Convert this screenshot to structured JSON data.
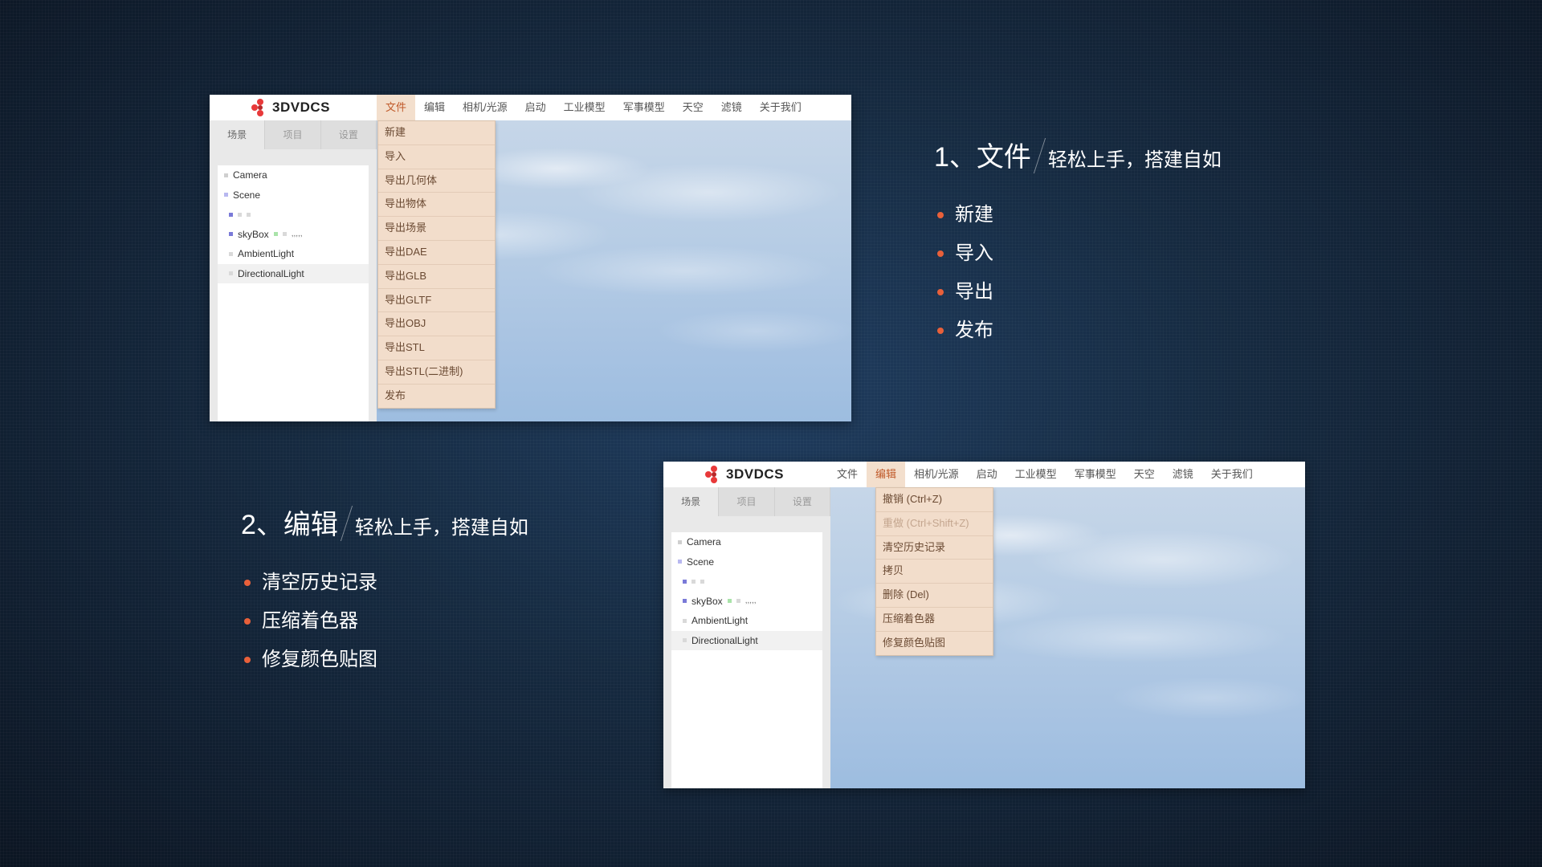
{
  "colors": {
    "accent": "#e8603a",
    "menu_active_bg": "#f3dfcd",
    "dropdown_bg": "#f2ddcb",
    "logo_red": "#e8393a"
  },
  "logo": {
    "text": "3DVDCS",
    "icon": "logo-dots-icon"
  },
  "menu": [
    "文件",
    "编辑",
    "相机/光源",
    "启动",
    "工业模型",
    "军事模型",
    "天空",
    "滤镜",
    "关于我们"
  ],
  "sidebar": {
    "tabs": [
      "场景",
      "项目",
      "设置"
    ],
    "tree": {
      "camera": "Camera",
      "scene": "Scene",
      "skybox": "skyBox",
      "skybox_suffix": ",,,,,",
      "ambient": "AmbientLight",
      "directional": "DirectionalLight"
    }
  },
  "panel1": {
    "active_menu": "文件",
    "dropdown": [
      "新建",
      "导入",
      "导出几何体",
      "导出物体",
      "导出场景",
      "导出DAE",
      "导出GLB",
      "导出GLTF",
      "导出OBJ",
      "导出STL",
      "导出STL(二进制)",
      "发布"
    ]
  },
  "panel2": {
    "active_menu": "编辑",
    "dropdown": [
      {
        "label": "撤销 (Ctrl+Z)",
        "disabled": false
      },
      {
        "label": "重做 (Ctrl+Shift+Z)",
        "disabled": true
      },
      {
        "label": "清空历史记录",
        "disabled": false
      },
      {
        "label": "拷贝",
        "disabled": false
      },
      {
        "label": "删除 (Del)",
        "disabled": false
      },
      {
        "label": "压缩着色器",
        "disabled": false
      },
      {
        "label": "修复颜色贴图",
        "disabled": false
      }
    ]
  },
  "feature1": {
    "title": "1、文件",
    "subtitle": "轻松上手，搭建自如",
    "bullets": [
      "新建",
      "导入",
      "导出",
      "发布"
    ]
  },
  "feature2": {
    "title": "2、编辑",
    "subtitle": "轻松上手，搭建自如",
    "bullets": [
      "清空历史记录",
      "压缩着色器",
      "修复颜色贴图"
    ]
  }
}
